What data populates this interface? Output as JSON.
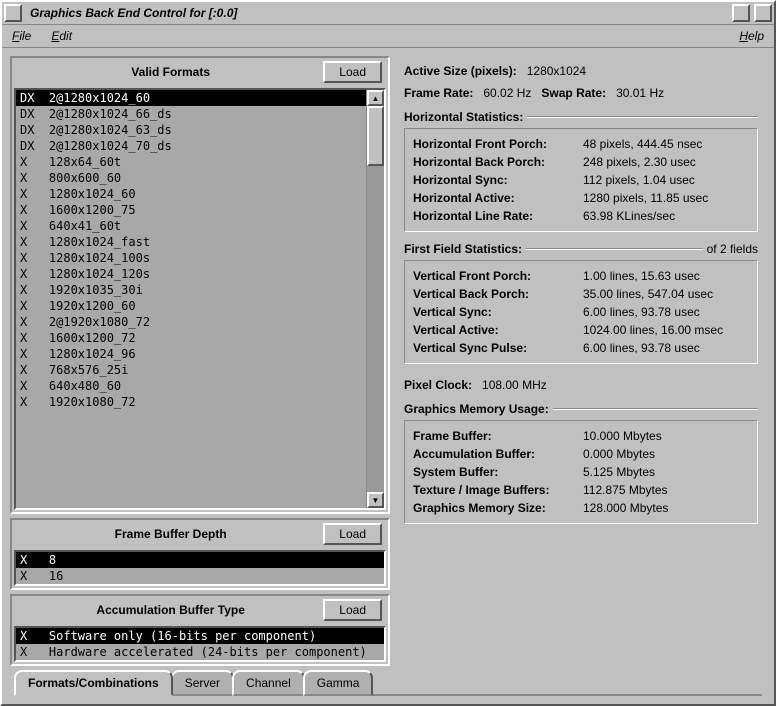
{
  "window": {
    "title": "Graphics Back End Control for [:0.0]"
  },
  "menu": {
    "file": "File",
    "edit": "Edit",
    "help": "Help"
  },
  "left": {
    "formats": {
      "title": "Valid Formats",
      "load": "Load",
      "items": [
        {
          "prefix": "DX",
          "label": "2@1280x1024_60",
          "selected": true
        },
        {
          "prefix": "DX",
          "label": "2@1280x1024_66_ds"
        },
        {
          "prefix": "DX",
          "label": "2@1280x1024_63_ds"
        },
        {
          "prefix": "DX",
          "label": "2@1280x1024_70_ds"
        },
        {
          "prefix": "X",
          "label": "128x64_60t"
        },
        {
          "prefix": "X",
          "label": "800x600_60"
        },
        {
          "prefix": "X",
          "label": "1280x1024_60"
        },
        {
          "prefix": "X",
          "label": "1600x1200_75"
        },
        {
          "prefix": "X",
          "label": "640x41_60t"
        },
        {
          "prefix": "X",
          "label": "1280x1024_fast"
        },
        {
          "prefix": "X",
          "label": "1280x1024_100s"
        },
        {
          "prefix": "X",
          "label": "1280x1024_120s"
        },
        {
          "prefix": "X",
          "label": "1920x1035_30i"
        },
        {
          "prefix": "X",
          "label": "1920x1200_60"
        },
        {
          "prefix": "X",
          "label": "2@1920x1080_72"
        },
        {
          "prefix": "X",
          "label": "1600x1200_72"
        },
        {
          "prefix": "X",
          "label": "1280x1024_96"
        },
        {
          "prefix": "X",
          "label": "768x576_25i"
        },
        {
          "prefix": "X",
          "label": "640x480_60"
        },
        {
          "prefix": "X",
          "label": "1920x1080_72"
        }
      ]
    },
    "depth": {
      "title": "Frame Buffer Depth",
      "load": "Load",
      "items": [
        {
          "prefix": "X",
          "label": "8",
          "selected": true
        },
        {
          "prefix": "X",
          "label": "16"
        }
      ]
    },
    "accum": {
      "title": "Accumulation Buffer Type",
      "load": "Load",
      "items": [
        {
          "prefix": "X",
          "label": "Software only (16-bits per component)",
          "selected": true
        },
        {
          "prefix": "X",
          "label": "Hardware accelerated (24-bits per component)"
        }
      ]
    }
  },
  "right": {
    "active_size": {
      "label": "Active Size (pixels):",
      "value": "1280x1024"
    },
    "frame_rate": {
      "label": "Frame Rate:",
      "value": "60.02 Hz"
    },
    "swap_rate": {
      "label": "Swap Rate:",
      "value": "30.01 Hz"
    },
    "hstats_title": "Horizontal Statistics:",
    "hstats": [
      {
        "label": "Horizontal Front Porch:",
        "value": "48 pixels, 444.45 nsec"
      },
      {
        "label": "Horizontal Back Porch:",
        "value": "248 pixels, 2.30 usec"
      },
      {
        "label": "Horizontal Sync:",
        "value": "112 pixels, 1.04 usec"
      },
      {
        "label": "Horizontal Active:",
        "value": "1280 pixels, 11.85 usec"
      },
      {
        "label": "Horizontal Line Rate:",
        "value": "63.98 KLines/sec"
      }
    ],
    "ffstats_title": "First Field Statistics:",
    "ffstats_extra": "of 2 fields",
    "ffstats": [
      {
        "label": "Vertical Front Porch:",
        "value": "1.00 lines, 15.63 usec"
      },
      {
        "label": "Vertical Back Porch:",
        "value": "35.00 lines, 547.04 usec"
      },
      {
        "label": "Vertical Sync:",
        "value": "6.00 lines, 93.78 usec"
      },
      {
        "label": "Vertical Active:",
        "value": "1024.00 lines, 16.00 msec"
      },
      {
        "label": "Vertical Sync Pulse:",
        "value": "6.00 lines, 93.78 usec"
      }
    ],
    "pixel_clock": {
      "label": "Pixel Clock:",
      "value": "108.00 MHz"
    },
    "mem_title": "Graphics Memory Usage:",
    "mem": [
      {
        "label": "Frame Buffer:",
        "value": "10.000 Mbytes"
      },
      {
        "label": "Accumulation Buffer:",
        "value": "0.000 Mbytes"
      },
      {
        "label": "System Buffer:",
        "value": "5.125 Mbytes"
      },
      {
        "label": "Texture / Image Buffers:",
        "value": "112.875 Mbytes"
      },
      {
        "label": "Graphics Memory Size:",
        "value": "128.000 Mbytes"
      }
    ]
  },
  "tabs": {
    "t0": "Formats/Combinations",
    "t1": "Server",
    "t2": "Channel",
    "t3": "Gamma"
  }
}
